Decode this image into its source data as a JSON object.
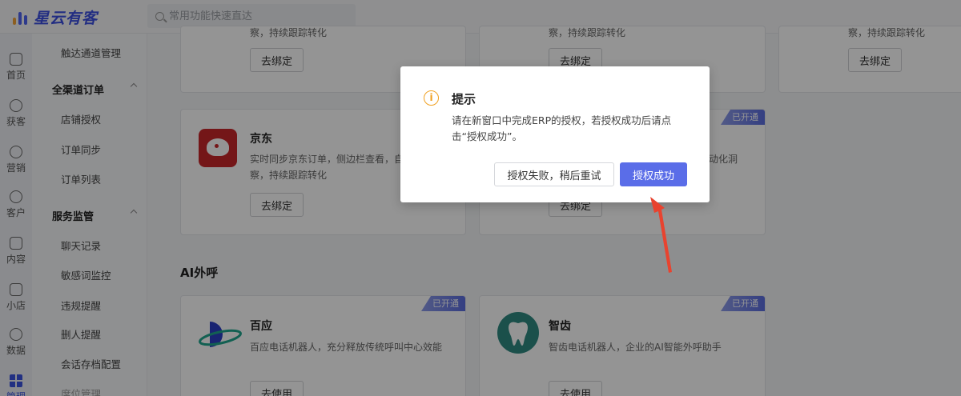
{
  "app": {
    "name": "星云有客"
  },
  "search": {
    "placeholder": "常用功能快速直达"
  },
  "rail": [
    {
      "label": "首页",
      "icon": "home-icon"
    },
    {
      "label": "获客",
      "icon": "user-add-icon"
    },
    {
      "label": "营销",
      "icon": "bulb-icon"
    },
    {
      "label": "客户",
      "icon": "user-icon"
    },
    {
      "label": "内容",
      "icon": "folder-icon"
    },
    {
      "label": "小店",
      "icon": "shop-icon"
    },
    {
      "label": "数据",
      "icon": "pie-icon"
    },
    {
      "label": "管理",
      "icon": "grid-icon"
    }
  ],
  "menu": {
    "top_item": "触达通道管理",
    "group_orders": {
      "title": "全渠道订单",
      "items": [
        "店铺授权",
        "订单同步",
        "订单列表"
      ]
    },
    "group_service": {
      "title": "服务监管",
      "items": [
        "聊天记录",
        "敏感词监控",
        "违规提醒",
        "删人提醒",
        "会话存档配置",
        "席位管理"
      ]
    }
  },
  "cards_top": {
    "desc_line": "察，持续跟踪转化",
    "buttons": [
      "去绑定",
      "去绑定",
      "去绑定"
    ]
  },
  "jd_card": {
    "title": "京东",
    "desc_line1": "实时同步京东订单，侧边栏查看，自",
    "desc_line2": "察，持续跟踪转化",
    "button": "去绑定"
  },
  "second_card": {
    "ribbon": "已开通",
    "desc_line1": "动化洞",
    "button": "去绑定"
  },
  "section": {
    "title": "AI外呼"
  },
  "baiying_card": {
    "title": "百应",
    "desc": "百应电话机器人，充分释放传统呼叫中心效能",
    "ribbon": "已开通",
    "button": "去使用"
  },
  "zhichi_card": {
    "title": "智齿",
    "desc": "智齿电话机器人，企业的AI智能外呼助手",
    "ribbon": "已开通",
    "button": "去使用"
  },
  "modal": {
    "title": "提示",
    "icon_glyph": "i",
    "body": "请在新窗口中完成ERP的授权，若授权成功后请点击“授权成功”。",
    "secondary_button": "授权失败，稍后重试",
    "primary_button": "授权成功"
  },
  "colors": {
    "accent": "#5a6de8",
    "arrow": "#e8432f",
    "warning": "#f0a020"
  }
}
